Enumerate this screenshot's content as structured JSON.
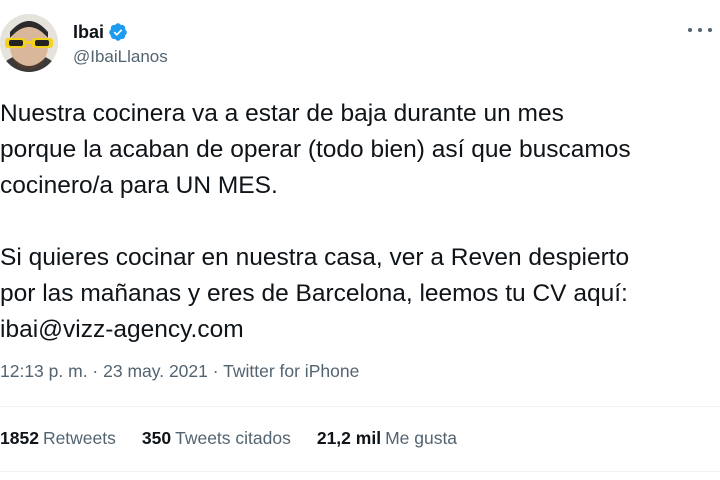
{
  "user": {
    "display_name": "Ibai",
    "handle": "@IbaiLlanos",
    "verified_icon": "verified-badge-icon",
    "avatar_icon": "avatar-with-sunglasses-icon"
  },
  "tweet": {
    "lines_paragraph_1": [
      "Nuestra cocinera va a estar de baja durante un mes",
      "porque la acaban de operar (todo bien) así que buscamos",
      "cocinero/a para UN MES."
    ],
    "lines_paragraph_2": [
      "Si quieres cocinar en nuestra casa, ver a Reven despierto",
      "por las mañanas y eres de Barcelona, leemos tu CV aquí:",
      "ibai@vizz-agency.com"
    ]
  },
  "meta": {
    "time": "12:13 p. m.",
    "sep1": " · ",
    "date": "23 may. 2021",
    "sep2": " · ",
    "source": "Twitter for iPhone"
  },
  "stats": {
    "retweets_count": "1852",
    "retweets_label": "Retweets",
    "quotes_count": "350",
    "quotes_label": "Tweets citados",
    "likes_count": "21,2 mil",
    "likes_label": "Me gusta"
  },
  "menu": {
    "icon": "more-horizontal-icon"
  },
  "colors": {
    "text_primary": "#0f1419",
    "text_secondary": "#536471",
    "verified_blue": "#1d9bf0",
    "divider": "#eff3f4"
  }
}
